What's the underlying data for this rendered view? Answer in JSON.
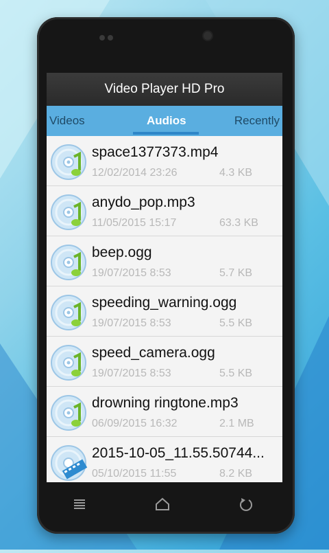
{
  "app": {
    "title": "Video Player HD Pro"
  },
  "tabs": [
    {
      "label": "Videos"
    },
    {
      "label": "Audios"
    },
    {
      "label": "Recently"
    }
  ],
  "files": [
    {
      "name": "space1377373.mp4",
      "date": "12/02/2014 23:26",
      "size": "4.3 KB",
      "icon": "disc-music-icon"
    },
    {
      "name": "anydo_pop.mp3",
      "date": "11/05/2015 15:17",
      "size": "63.3 KB",
      "icon": "disc-music-icon"
    },
    {
      "name": "beep.ogg",
      "date": "19/07/2015 8:53",
      "size": "5.7 KB",
      "icon": "disc-music-icon"
    },
    {
      "name": "speeding_warning.ogg",
      "date": "19/07/2015 8:53",
      "size": "5.5 KB",
      "icon": "disc-music-icon"
    },
    {
      "name": "speed_camera.ogg",
      "date": "19/07/2015 8:53",
      "size": "5.5 KB",
      "icon": "disc-music-icon"
    },
    {
      "name": "drowning ringtone.mp3",
      "date": "06/09/2015 16:32",
      "size": "2.1 MB",
      "icon": "disc-music-icon"
    },
    {
      "name": "2015-10-05_11.55.50744...",
      "date": "05/10/2015 11:55",
      "size": "8.2 KB",
      "icon": "disc-film-icon"
    }
  ],
  "colors": {
    "tab_bar": "#5aaee0",
    "title_bar": "#2f2f2f",
    "accent": "#2e86c8"
  }
}
